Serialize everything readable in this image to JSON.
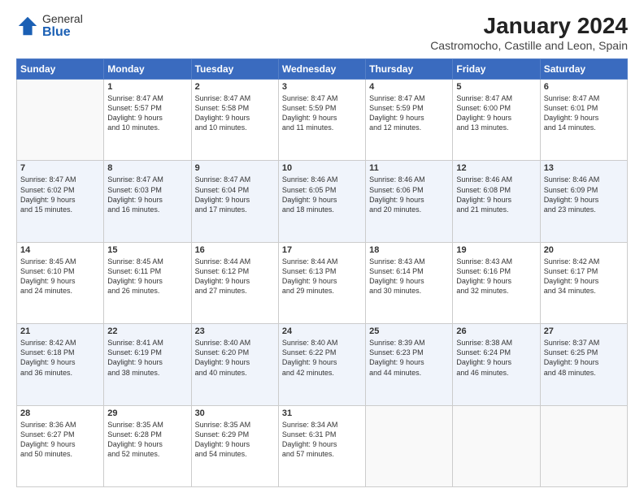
{
  "logo": {
    "general": "General",
    "blue": "Blue"
  },
  "header": {
    "month": "January 2024",
    "location": "Castromocho, Castille and Leon, Spain"
  },
  "weekdays": [
    "Sunday",
    "Monday",
    "Tuesday",
    "Wednesday",
    "Thursday",
    "Friday",
    "Saturday"
  ],
  "weeks": [
    [
      {
        "day": "",
        "info": ""
      },
      {
        "day": "1",
        "info": "Sunrise: 8:47 AM\nSunset: 5:57 PM\nDaylight: 9 hours\nand 10 minutes."
      },
      {
        "day": "2",
        "info": "Sunrise: 8:47 AM\nSunset: 5:58 PM\nDaylight: 9 hours\nand 10 minutes."
      },
      {
        "day": "3",
        "info": "Sunrise: 8:47 AM\nSunset: 5:59 PM\nDaylight: 9 hours\nand 11 minutes."
      },
      {
        "day": "4",
        "info": "Sunrise: 8:47 AM\nSunset: 5:59 PM\nDaylight: 9 hours\nand 12 minutes."
      },
      {
        "day": "5",
        "info": "Sunrise: 8:47 AM\nSunset: 6:00 PM\nDaylight: 9 hours\nand 13 minutes."
      },
      {
        "day": "6",
        "info": "Sunrise: 8:47 AM\nSunset: 6:01 PM\nDaylight: 9 hours\nand 14 minutes."
      }
    ],
    [
      {
        "day": "7",
        "info": "Sunrise: 8:47 AM\nSunset: 6:02 PM\nDaylight: 9 hours\nand 15 minutes."
      },
      {
        "day": "8",
        "info": "Sunrise: 8:47 AM\nSunset: 6:03 PM\nDaylight: 9 hours\nand 16 minutes."
      },
      {
        "day": "9",
        "info": "Sunrise: 8:47 AM\nSunset: 6:04 PM\nDaylight: 9 hours\nand 17 minutes."
      },
      {
        "day": "10",
        "info": "Sunrise: 8:46 AM\nSunset: 6:05 PM\nDaylight: 9 hours\nand 18 minutes."
      },
      {
        "day": "11",
        "info": "Sunrise: 8:46 AM\nSunset: 6:06 PM\nDaylight: 9 hours\nand 20 minutes."
      },
      {
        "day": "12",
        "info": "Sunrise: 8:46 AM\nSunset: 6:08 PM\nDaylight: 9 hours\nand 21 minutes."
      },
      {
        "day": "13",
        "info": "Sunrise: 8:46 AM\nSunset: 6:09 PM\nDaylight: 9 hours\nand 23 minutes."
      }
    ],
    [
      {
        "day": "14",
        "info": "Sunrise: 8:45 AM\nSunset: 6:10 PM\nDaylight: 9 hours\nand 24 minutes."
      },
      {
        "day": "15",
        "info": "Sunrise: 8:45 AM\nSunset: 6:11 PM\nDaylight: 9 hours\nand 26 minutes."
      },
      {
        "day": "16",
        "info": "Sunrise: 8:44 AM\nSunset: 6:12 PM\nDaylight: 9 hours\nand 27 minutes."
      },
      {
        "day": "17",
        "info": "Sunrise: 8:44 AM\nSunset: 6:13 PM\nDaylight: 9 hours\nand 29 minutes."
      },
      {
        "day": "18",
        "info": "Sunrise: 8:43 AM\nSunset: 6:14 PM\nDaylight: 9 hours\nand 30 minutes."
      },
      {
        "day": "19",
        "info": "Sunrise: 8:43 AM\nSunset: 6:16 PM\nDaylight: 9 hours\nand 32 minutes."
      },
      {
        "day": "20",
        "info": "Sunrise: 8:42 AM\nSunset: 6:17 PM\nDaylight: 9 hours\nand 34 minutes."
      }
    ],
    [
      {
        "day": "21",
        "info": "Sunrise: 8:42 AM\nSunset: 6:18 PM\nDaylight: 9 hours\nand 36 minutes."
      },
      {
        "day": "22",
        "info": "Sunrise: 8:41 AM\nSunset: 6:19 PM\nDaylight: 9 hours\nand 38 minutes."
      },
      {
        "day": "23",
        "info": "Sunrise: 8:40 AM\nSunset: 6:20 PM\nDaylight: 9 hours\nand 40 minutes."
      },
      {
        "day": "24",
        "info": "Sunrise: 8:40 AM\nSunset: 6:22 PM\nDaylight: 9 hours\nand 42 minutes."
      },
      {
        "day": "25",
        "info": "Sunrise: 8:39 AM\nSunset: 6:23 PM\nDaylight: 9 hours\nand 44 minutes."
      },
      {
        "day": "26",
        "info": "Sunrise: 8:38 AM\nSunset: 6:24 PM\nDaylight: 9 hours\nand 46 minutes."
      },
      {
        "day": "27",
        "info": "Sunrise: 8:37 AM\nSunset: 6:25 PM\nDaylight: 9 hours\nand 48 minutes."
      }
    ],
    [
      {
        "day": "28",
        "info": "Sunrise: 8:36 AM\nSunset: 6:27 PM\nDaylight: 9 hours\nand 50 minutes."
      },
      {
        "day": "29",
        "info": "Sunrise: 8:35 AM\nSunset: 6:28 PM\nDaylight: 9 hours\nand 52 minutes."
      },
      {
        "day": "30",
        "info": "Sunrise: 8:35 AM\nSunset: 6:29 PM\nDaylight: 9 hours\nand 54 minutes."
      },
      {
        "day": "31",
        "info": "Sunrise: 8:34 AM\nSunset: 6:31 PM\nDaylight: 9 hours\nand 57 minutes."
      },
      {
        "day": "",
        "info": ""
      },
      {
        "day": "",
        "info": ""
      },
      {
        "day": "",
        "info": ""
      }
    ]
  ]
}
